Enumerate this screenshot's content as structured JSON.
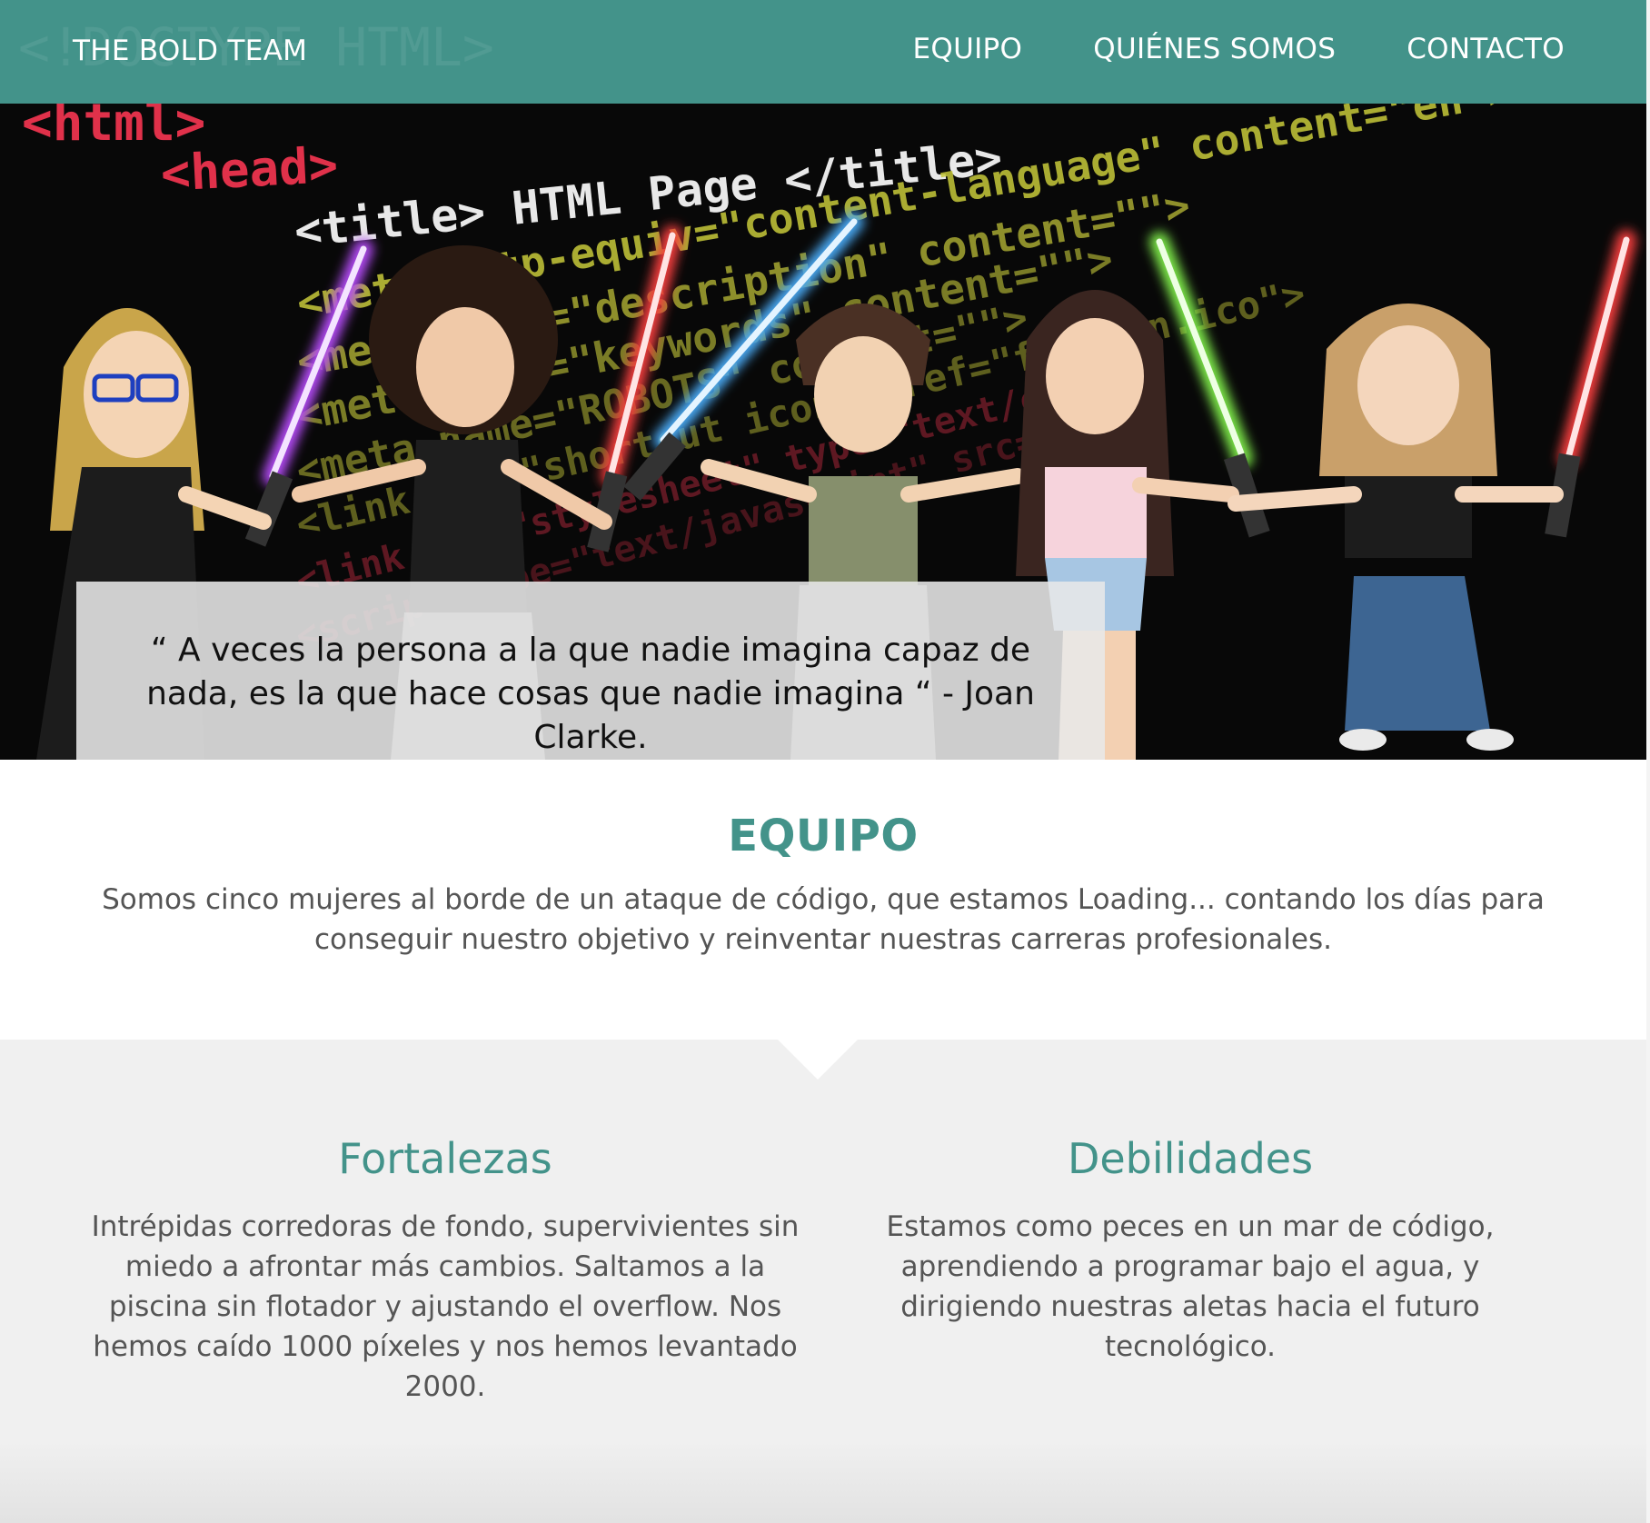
{
  "header": {
    "brand": "THE BOLD TEAM",
    "nav": [
      {
        "label": "EQUIPO"
      },
      {
        "label": "QUIÉNES SOMOS"
      },
      {
        "label": "CONTACTO"
      }
    ],
    "background_code": "<!DOCTYPE HTML>",
    "color": "#43938a"
  },
  "hero": {
    "code_lines": [
      "<html>",
      "<head>",
      "<title> HTML Page </title>",
      "<meta http-equiv=\"content-language\" content=\"en\">",
      "<meta name=\"description\" content=\"\">",
      "<meta name=\"keywords\" content=\"\">",
      "<meta name=\"ROBOTS\" content=\"\">",
      "<link rel=\"shortcut icon\" href=\"favicon.ico\">",
      "<link rel=\"stylesheet\" type=\"text/css\">",
      "<script type=\"text/javascript\" src=\"/js\">"
    ],
    "quote": "“ A veces la persona a la que nadie imagina capaz de nada, es la que hace cosas que nadie imagina “ - Joan Clarke.",
    "characters": [
      {
        "name": "character-blonde-glasses",
        "saber_color": "#b44cf5"
      },
      {
        "name": "character-curly-hair",
        "saber_color": "#f23c3c"
      },
      {
        "name": "character-short-hair",
        "saber_color": "#49a8f2"
      },
      {
        "name": "character-long-dark-hair",
        "saber_color": "#7de84a"
      },
      {
        "name": "character-light-brown-hair",
        "saber_color": "#f23c3c"
      }
    ]
  },
  "team": {
    "title": "EQUIPO",
    "text": "Somos cinco mujeres al borde de un ataque de código, que estamos Loading... contando los días para conseguir nuestro objetivo y reinventar nuestras carreras profesionales."
  },
  "strengths": {
    "title": "Fortalezas",
    "text": "Intrépidas corredoras de fondo, supervivientes sin miedo a afrontar más cambios. Saltamos a la piscina sin flotador y ajustando el overflow. Nos hemos caído 1000 píxeles y nos hemos levantado 2000."
  },
  "weaknesses": {
    "title": "Debilidades",
    "text": "Estamos como peces en un mar de código, aprendiendo a programar bajo el agua, y dirigiendo nuestras aletas hacia el futuro tecnológico."
  }
}
